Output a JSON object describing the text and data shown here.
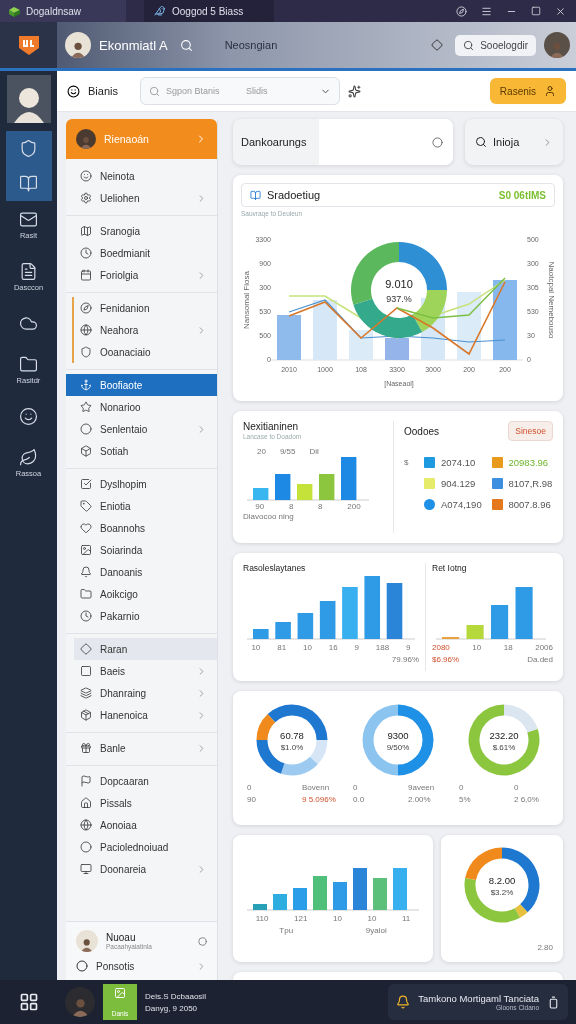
{
  "titlebar": {
    "app_name": "Dogaldnsaw",
    "tab": "Ooggod 5 Biass"
  },
  "header": {
    "user_name": "Ekonmiatl A",
    "section": "Neosngian",
    "search": "Sooelogdir"
  },
  "rail": {
    "items": [
      {
        "selected": true
      },
      {
        "selected": true
      },
      {
        "label": "Rasit",
        "selected": false
      },
      {
        "label": "Dasccon",
        "selected": false
      },
      {
        "selected": false
      },
      {
        "label": "Rasitdr",
        "selected": false
      },
      {
        "selected": false
      },
      {
        "label": "Rassoa",
        "selected": false
      }
    ]
  },
  "toolbar": {
    "title": "Bianis",
    "search_placeholder": "Sgpon Btanis",
    "filter": "Slidis",
    "button": "Rasenis"
  },
  "sidebar": {
    "header": "Rienaoán",
    "groups": [
      {
        "accent": false,
        "items": [
          {
            "label": "Neinota",
            "chevron": false,
            "selected": false,
            "hovered": false
          },
          {
            "label": "Ueliohen",
            "chevron": true,
            "selected": false,
            "hovered": false
          }
        ]
      },
      {
        "accent": false,
        "items": [
          {
            "label": "Sranogia",
            "chevron": false,
            "selected": false,
            "hovered": false
          },
          {
            "label": "Boedmianit",
            "chevron": false,
            "selected": false,
            "hovered": false
          },
          {
            "label": "Foriolgia",
            "chevron": true,
            "selected": false,
            "hovered": false
          }
        ]
      },
      {
        "accent": true,
        "items": [
          {
            "label": "Fenidanion",
            "chevron": false,
            "selected": false,
            "hovered": false
          },
          {
            "label": "Neahora",
            "chevron": true,
            "selected": false,
            "hovered": false
          },
          {
            "label": "Ooanaciaio",
            "chevron": false,
            "selected": false,
            "hovered": false
          }
        ]
      },
      {
        "accent": false,
        "items": [
          {
            "label": "Boofiaote",
            "chevron": false,
            "selected": true,
            "hovered": false
          },
          {
            "label": "Nonarioo",
            "chevron": false,
            "selected": false,
            "hovered": false
          },
          {
            "label": "Senlentaio",
            "chevron": true,
            "selected": false,
            "hovered": false
          },
          {
            "label": "Sotiah",
            "chevron": false,
            "selected": false,
            "hovered": false
          }
        ]
      },
      {
        "accent": false,
        "items": [
          {
            "label": "Dyslhopim",
            "chevron": false,
            "selected": false,
            "hovered": false
          },
          {
            "label": "Eniotia",
            "chevron": false,
            "selected": false,
            "hovered": false
          },
          {
            "label": "Boannohs",
            "chevron": false,
            "selected": false,
            "hovered": false
          },
          {
            "label": "Soiarinda",
            "chevron": false,
            "selected": false,
            "hovered": false
          },
          {
            "label": "Danoanis",
            "chevron": false,
            "selected": false,
            "hovered": false
          },
          {
            "label": "Aoikcigo",
            "chevron": false,
            "selected": false,
            "hovered": false
          },
          {
            "label": "Pakarnio",
            "chevron": false,
            "selected": false,
            "hovered": false
          }
        ]
      },
      {
        "accent": false,
        "items": [
          {
            "label": "Raran",
            "chevron": false,
            "selected": false,
            "hovered": true
          },
          {
            "label": "Baeis",
            "chevron": true,
            "selected": false,
            "hovered": false
          },
          {
            "label": "Dhanraing",
            "chevron": true,
            "selected": false,
            "hovered": false
          },
          {
            "label": "Hanenoica",
            "chevron": true,
            "selected": false,
            "hovered": false
          }
        ]
      },
      {
        "accent": false,
        "items": [
          {
            "label": "Banle",
            "chevron": true,
            "selected": false,
            "hovered": false
          }
        ]
      },
      {
        "accent": false,
        "items": [
          {
            "label": "Dopcaaran",
            "chevron": false,
            "selected": false,
            "hovered": false
          },
          {
            "label": "Pissals",
            "chevron": false,
            "selected": false,
            "hovered": false
          },
          {
            "label": "Aonoiaa",
            "chevron": false,
            "selected": false,
            "hovered": false
          },
          {
            "label": "Paciolednoiuad",
            "chevron": false,
            "selected": false,
            "hovered": false
          },
          {
            "label": "Doonareia",
            "chevron": true,
            "selected": false,
            "hovered": false
          }
        ]
      }
    ],
    "user": {
      "name": "Nuoau",
      "subtitle": "Pacaahyaiatinla"
    },
    "footer_item": "Ponsotis"
  },
  "summary": {
    "field_label": "Dankoarungs",
    "link": "Inioja"
  },
  "overview": {
    "title": "Sradoetiug",
    "badge": "S0 06tIMS",
    "subtitle": "Sauvraqe to Deuleun",
    "left_axis_title": "Nansomal Fiosa",
    "right_axis_title": "Naotcpal Nemebouso",
    "left_ticks": [
      "3300",
      "900",
      "300",
      "530",
      "500",
      "0"
    ],
    "right_ticks": [
      "500",
      "300",
      "305",
      "530",
      "30",
      "0"
    ],
    "x_labels": [
      "2010",
      "1000",
      "108",
      "3300",
      "3000",
      "200",
      "200"
    ],
    "x_title": "[Naseaol]",
    "donut_value": "9.010",
    "donut_percent": "937.%"
  },
  "breakdown": {
    "title": "Nexitianinen",
    "subtitle": "Lancase to Doadom",
    "bar_labels": [
      "20",
      "9/55",
      "Dil"
    ],
    "x_labels": [
      "90",
      "8",
      "8",
      "200"
    ],
    "caption": "Dlavocoo ning",
    "orders_title": "Oodoes",
    "orders_button": "Sinesoe",
    "currency": "$",
    "legend": [
      {
        "value": "2074.10",
        "color": "#1e9be0",
        "kind": "square",
        "positive": false
      },
      {
        "value": "20983.96",
        "color": "#e89a1c",
        "kind": "square",
        "positive": true
      },
      {
        "value": "904.129",
        "color": "#e6ec6a",
        "kind": "square",
        "positive": false
      },
      {
        "value": "8107,R.98",
        "color": "#3c8ee0",
        "kind": "square",
        "positive": false
      },
      {
        "value": "A074,190",
        "color": "#1e90e6",
        "kind": "circle",
        "positive": false
      },
      {
        "value": "8007.8.96",
        "color": "#e6781c",
        "kind": "square",
        "positive": false
      }
    ]
  },
  "distribution": {
    "left": {
      "title": "Rasoleslaytanes",
      "x_labels": [
        "10",
        "81",
        "10",
        "16",
        "9",
        "188",
        "9"
      ],
      "footer": "79.96%"
    },
    "right": {
      "title": "Ret Iotng",
      "x_labels": [
        {
          "text": "2080",
          "alert": true
        },
        {
          "text": "10",
          "alert": false
        },
        {
          "text": "18",
          "alert": false
        },
        {
          "text": "2006",
          "alert": false
        }
      ],
      "footers": [
        {
          "text": "$6.96%",
          "alert": true
        },
        {
          "text": "Da.ded",
          "alert": false
        }
      ]
    }
  },
  "gauges": [
    {
      "kind": "multi",
      "value": "60.78",
      "percent": "$1.0%",
      "figures": [
        {
          "text": "0",
          "alert": false
        },
        {
          "text": "Bovenn",
          "alert": false
        },
        {
          "text": "90",
          "alert": false
        },
        {
          "text": "9 5.096%",
          "alert": true
        }
      ]
    },
    {
      "kind": "blue",
      "value": "9300",
      "percent": "9/50%",
      "figures": [
        {
          "text": "0",
          "alert": false
        },
        {
          "text": "9aveen",
          "alert": false
        },
        {
          "text": "0.0",
          "alert": false
        },
        {
          "text": "2.00%",
          "alert": false
        }
      ]
    },
    {
      "kind": "green",
      "value": "232.20",
      "percent": "$.61%",
      "figures": [
        {
          "text": "0",
          "alert": false
        },
        {
          "text": "0",
          "alert": false
        },
        {
          "text": "5%",
          "alert": false
        },
        {
          "text": "2 6,0%",
          "alert": false
        }
      ]
    }
  ],
  "trend": {
    "x_labels": [
      "110",
      "121",
      "10",
      "10",
      "11"
    ],
    "captions": [
      "Tpu",
      "9yaloi"
    ],
    "donut_value": "8.2.00",
    "donut_percent": "$3.2%",
    "note": "2.80"
  },
  "taskbar": {
    "tile": "Danis",
    "lines": [
      "Deis.S Dcbaaosil",
      "Danyg, 9 2050"
    ],
    "tray_text": "Tamkono Mortigaml Tanciata",
    "tray_sub": "Gloons Cldano"
  }
}
